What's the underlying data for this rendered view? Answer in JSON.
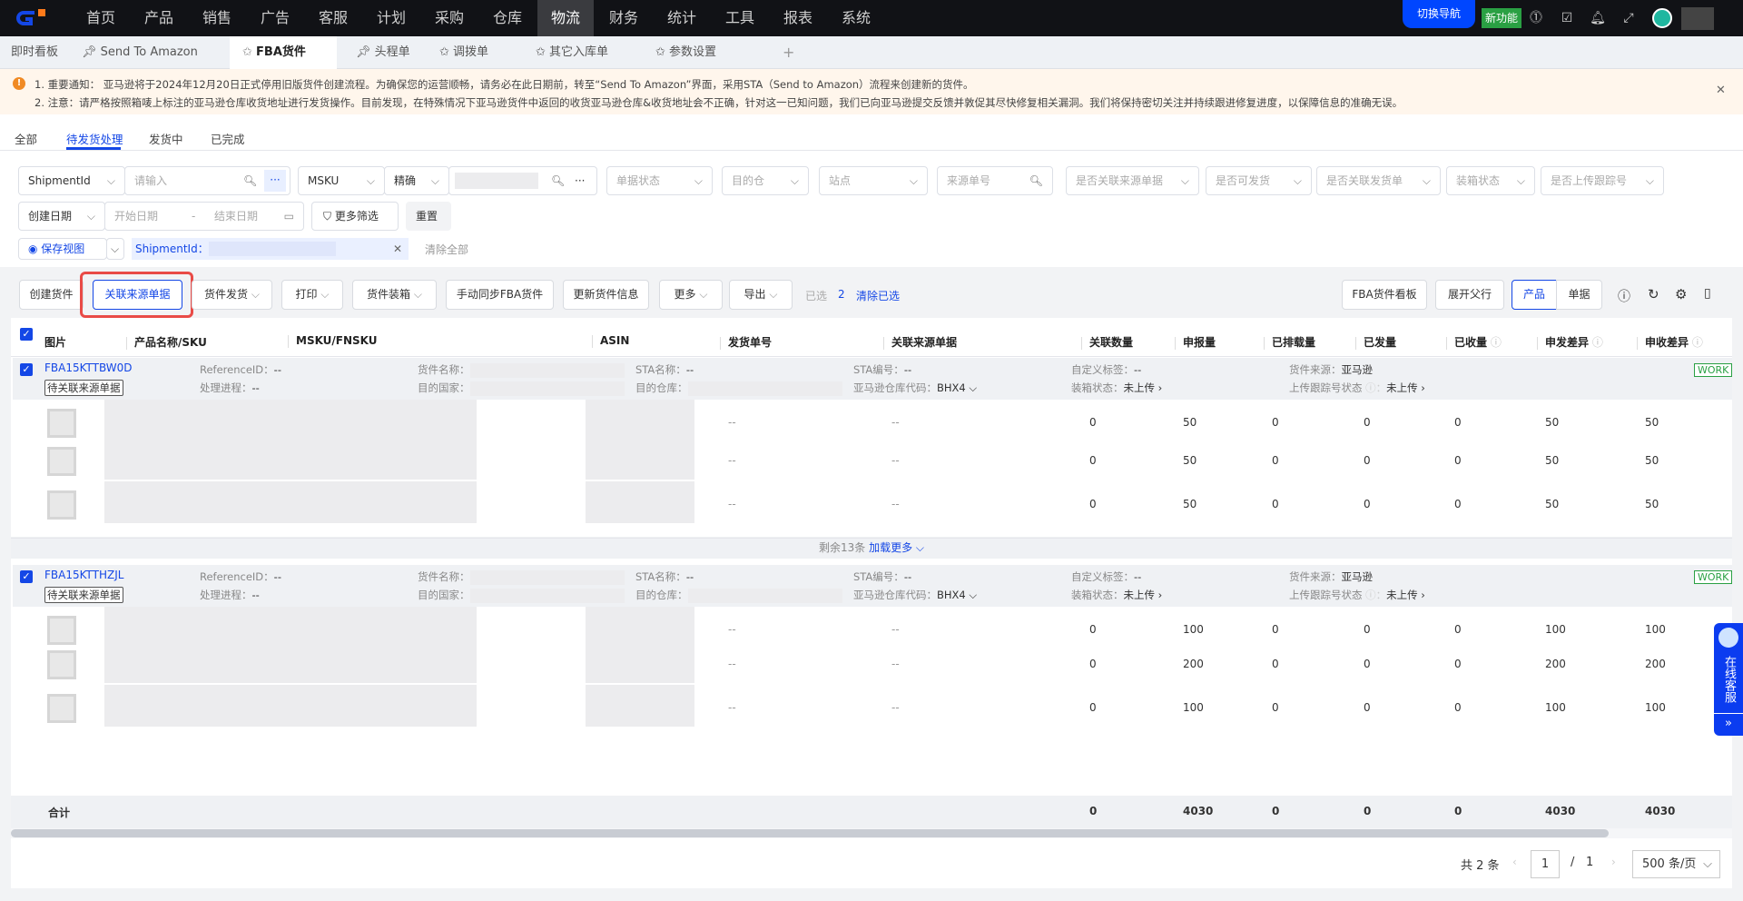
{
  "nav": {
    "items": [
      "首页",
      "产品",
      "销售",
      "广告",
      "客服",
      "计划",
      "采购",
      "仓库",
      "物流",
      "财务",
      "统计",
      "工具",
      "报表",
      "系统"
    ],
    "active": 8,
    "switch_nav": "切换导航",
    "new_feature": "新功能"
  },
  "tabs": {
    "dashboard": "即时看板",
    "items": [
      "Send To Amazon",
      "FBA货件",
      "头程单",
      "调拨单",
      "其它入库单",
      "参数设置"
    ],
    "add": "+"
  },
  "notice": {
    "line1": "1. 重要通知： 亚马逊将于2024年12月20日正式停用旧版货件创建流程。为确保您的运营顺畅，请务必在此日期前，转至“Send To Amazon”界面，采用STA（Send to Amazon）流程来创建新的货件。",
    "line2": "2. 注意：请严格按照箱唛上标注的亚马逊仓库收货地址进行发货操作。目前发现，在特殊情况下亚马逊货件中返回的收货亚马逊仓库&收货地址会不正确，针对这一已知问题，我们已向亚马逊提交反馈并敦促其尽快修复相关漏洞。我们将保持密切关注并持续跟进修复进度，以保障信息的准确无误。"
  },
  "status_tabs": [
    "全部",
    "待发货处理",
    "发货中",
    "已完成"
  ],
  "filters": {
    "shipment_field": "ShipmentId",
    "shipment_placeholder": "请输入",
    "msku_field": "MSKU",
    "match_mode": "精确",
    "doc_status": "单据状态",
    "dest_wh": "目的仓",
    "site": "站点",
    "source_no": "来源单号",
    "linked_source": "是否关联来源单据",
    "can_ship": "是否可发货",
    "linked_ship": "是否关联发货单",
    "packing_status": "装箱状态",
    "tracking_uploaded": "是否上传跟踪号",
    "date_field": "创建日期",
    "start_date": "开始日期",
    "end_date": "结束日期",
    "more_filters": "更多筛选",
    "reset": "重置",
    "save_view": "保存视图",
    "tag_label": "ShipmentId：",
    "clear_all": "清除全部"
  },
  "toolbar": {
    "create": "创建货件",
    "link_source": "关联来源单据",
    "ship": "货件发货",
    "print": "打印",
    "packing": "货件装箱",
    "sync": "手动同步FBA货件",
    "update": "更新货件信息",
    "more": "更多",
    "export": "导出",
    "selected_label": "已选",
    "selected_count": "2",
    "clear_selected": "清除已选",
    "board": "FBA货件看板",
    "expand_parent": "展开父行",
    "view_product": "产品",
    "view_doc": "单据"
  },
  "columns": [
    "图片",
    "产品名称/SKU",
    "MSKU/FNSKU",
    "ASIN",
    "发货单号",
    "关联来源单据",
    "关联数量",
    "申报量",
    "已排载量",
    "已发量",
    "已收量",
    "申发差异",
    "申收差异"
  ],
  "groups": [
    {
      "id": "FBA15KTTBW0D",
      "pending": "待关联来源单据",
      "ref_label": "ReferenceID：",
      "ref": "--",
      "progress_label": "处理进程：",
      "progress": "--",
      "name_label": "货件名称：",
      "country_label": "目的国家：",
      "sta_name_label": "STA名称：",
      "sta_name": "--",
      "dest_wh_label": "目的仓库：",
      "sta_no_label": "STA编号：",
      "sta_no": "--",
      "fc_label": "亚马逊仓库代码：",
      "fc": "BHX4",
      "tag_label": "自定义标签：",
      "tag": "--",
      "pack_label": "装箱状态：",
      "pack": "未上传",
      "source_label": "货件来源：",
      "source": "亚马逊",
      "track_label": "上传跟踪号状态",
      "track": "未上传",
      "status": "WORK",
      "rows": [
        [
          "--",
          "--",
          "0",
          "50",
          "0",
          "0",
          "0",
          "50",
          "50"
        ],
        [
          "--",
          "--",
          "0",
          "50",
          "0",
          "0",
          "0",
          "50",
          "50"
        ],
        [
          "--",
          "--",
          "0",
          "50",
          "0",
          "0",
          "0",
          "50",
          "50"
        ]
      ]
    },
    {
      "id": "FBA15KTTHZJL",
      "pending": "待关联来源单据",
      "ref_label": "ReferenceID：",
      "ref": "--",
      "progress_label": "处理进程：",
      "progress": "--",
      "name_label": "货件名称：",
      "country_label": "目的国家：",
      "sta_name_label": "STA名称：",
      "sta_name": "--",
      "dest_wh_label": "目的仓库：",
      "sta_no_label": "STA编号：",
      "sta_no": "--",
      "fc_label": "亚马逊仓库代码：",
      "fc": "BHX4",
      "tag_label": "自定义标签：",
      "tag": "--",
      "pack_label": "装箱状态：",
      "pack": "未上传",
      "source_label": "货件来源：",
      "source": "亚马逊",
      "track_label": "上传跟踪号状态",
      "track": "未上传",
      "status": "WORK",
      "rows": [
        [
          "--",
          "--",
          "0",
          "100",
          "0",
          "0",
          "0",
          "100",
          "100"
        ],
        [
          "--",
          "--",
          "0",
          "200",
          "0",
          "0",
          "0",
          "200",
          "200"
        ],
        [
          "--",
          "--",
          "0",
          "100",
          "0",
          "0",
          "0",
          "100",
          "100"
        ]
      ]
    }
  ],
  "load_more": {
    "remaining": "剩余13条",
    "label": "加载更多"
  },
  "totals": {
    "label": "合计",
    "values": [
      "0",
      "4030",
      "0",
      "0",
      "0",
      "4030",
      "4030"
    ]
  },
  "pagination": {
    "total": "共 2 条",
    "page": "1",
    "sep": "/",
    "pages": "1",
    "page_size": "500 条/页"
  },
  "chat": {
    "label": "在线客服",
    "collapse": "»"
  }
}
